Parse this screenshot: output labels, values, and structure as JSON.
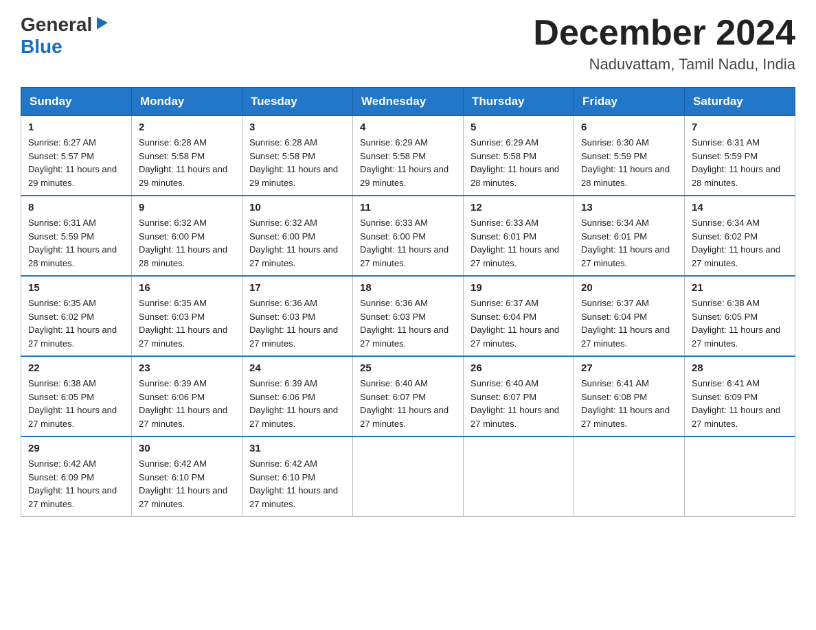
{
  "logo": {
    "general": "General",
    "blue": "Blue"
  },
  "title": {
    "month_year": "December 2024",
    "location": "Naduvattam, Tamil Nadu, India"
  },
  "headers": [
    "Sunday",
    "Monday",
    "Tuesday",
    "Wednesday",
    "Thursday",
    "Friday",
    "Saturday"
  ],
  "weeks": [
    [
      {
        "day": "1",
        "sunrise": "6:27 AM",
        "sunset": "5:57 PM",
        "daylight": "11 hours and 29 minutes."
      },
      {
        "day": "2",
        "sunrise": "6:28 AM",
        "sunset": "5:58 PM",
        "daylight": "11 hours and 29 minutes."
      },
      {
        "day": "3",
        "sunrise": "6:28 AM",
        "sunset": "5:58 PM",
        "daylight": "11 hours and 29 minutes."
      },
      {
        "day": "4",
        "sunrise": "6:29 AM",
        "sunset": "5:58 PM",
        "daylight": "11 hours and 29 minutes."
      },
      {
        "day": "5",
        "sunrise": "6:29 AM",
        "sunset": "5:58 PM",
        "daylight": "11 hours and 28 minutes."
      },
      {
        "day": "6",
        "sunrise": "6:30 AM",
        "sunset": "5:59 PM",
        "daylight": "11 hours and 28 minutes."
      },
      {
        "day": "7",
        "sunrise": "6:31 AM",
        "sunset": "5:59 PM",
        "daylight": "11 hours and 28 minutes."
      }
    ],
    [
      {
        "day": "8",
        "sunrise": "6:31 AM",
        "sunset": "5:59 PM",
        "daylight": "11 hours and 28 minutes."
      },
      {
        "day": "9",
        "sunrise": "6:32 AM",
        "sunset": "6:00 PM",
        "daylight": "11 hours and 28 minutes."
      },
      {
        "day": "10",
        "sunrise": "6:32 AM",
        "sunset": "6:00 PM",
        "daylight": "11 hours and 27 minutes."
      },
      {
        "day": "11",
        "sunrise": "6:33 AM",
        "sunset": "6:00 PM",
        "daylight": "11 hours and 27 minutes."
      },
      {
        "day": "12",
        "sunrise": "6:33 AM",
        "sunset": "6:01 PM",
        "daylight": "11 hours and 27 minutes."
      },
      {
        "day": "13",
        "sunrise": "6:34 AM",
        "sunset": "6:01 PM",
        "daylight": "11 hours and 27 minutes."
      },
      {
        "day": "14",
        "sunrise": "6:34 AM",
        "sunset": "6:02 PM",
        "daylight": "11 hours and 27 minutes."
      }
    ],
    [
      {
        "day": "15",
        "sunrise": "6:35 AM",
        "sunset": "6:02 PM",
        "daylight": "11 hours and 27 minutes."
      },
      {
        "day": "16",
        "sunrise": "6:35 AM",
        "sunset": "6:03 PM",
        "daylight": "11 hours and 27 minutes."
      },
      {
        "day": "17",
        "sunrise": "6:36 AM",
        "sunset": "6:03 PM",
        "daylight": "11 hours and 27 minutes."
      },
      {
        "day": "18",
        "sunrise": "6:36 AM",
        "sunset": "6:03 PM",
        "daylight": "11 hours and 27 minutes."
      },
      {
        "day": "19",
        "sunrise": "6:37 AM",
        "sunset": "6:04 PM",
        "daylight": "11 hours and 27 minutes."
      },
      {
        "day": "20",
        "sunrise": "6:37 AM",
        "sunset": "6:04 PM",
        "daylight": "11 hours and 27 minutes."
      },
      {
        "day": "21",
        "sunrise": "6:38 AM",
        "sunset": "6:05 PM",
        "daylight": "11 hours and 27 minutes."
      }
    ],
    [
      {
        "day": "22",
        "sunrise": "6:38 AM",
        "sunset": "6:05 PM",
        "daylight": "11 hours and 27 minutes."
      },
      {
        "day": "23",
        "sunrise": "6:39 AM",
        "sunset": "6:06 PM",
        "daylight": "11 hours and 27 minutes."
      },
      {
        "day": "24",
        "sunrise": "6:39 AM",
        "sunset": "6:06 PM",
        "daylight": "11 hours and 27 minutes."
      },
      {
        "day": "25",
        "sunrise": "6:40 AM",
        "sunset": "6:07 PM",
        "daylight": "11 hours and 27 minutes."
      },
      {
        "day": "26",
        "sunrise": "6:40 AM",
        "sunset": "6:07 PM",
        "daylight": "11 hours and 27 minutes."
      },
      {
        "day": "27",
        "sunrise": "6:41 AM",
        "sunset": "6:08 PM",
        "daylight": "11 hours and 27 minutes."
      },
      {
        "day": "28",
        "sunrise": "6:41 AM",
        "sunset": "6:09 PM",
        "daylight": "11 hours and 27 minutes."
      }
    ],
    [
      {
        "day": "29",
        "sunrise": "6:42 AM",
        "sunset": "6:09 PM",
        "daylight": "11 hours and 27 minutes."
      },
      {
        "day": "30",
        "sunrise": "6:42 AM",
        "sunset": "6:10 PM",
        "daylight": "11 hours and 27 minutes."
      },
      {
        "day": "31",
        "sunrise": "6:42 AM",
        "sunset": "6:10 PM",
        "daylight": "11 hours and 27 minutes."
      },
      null,
      null,
      null,
      null
    ]
  ]
}
